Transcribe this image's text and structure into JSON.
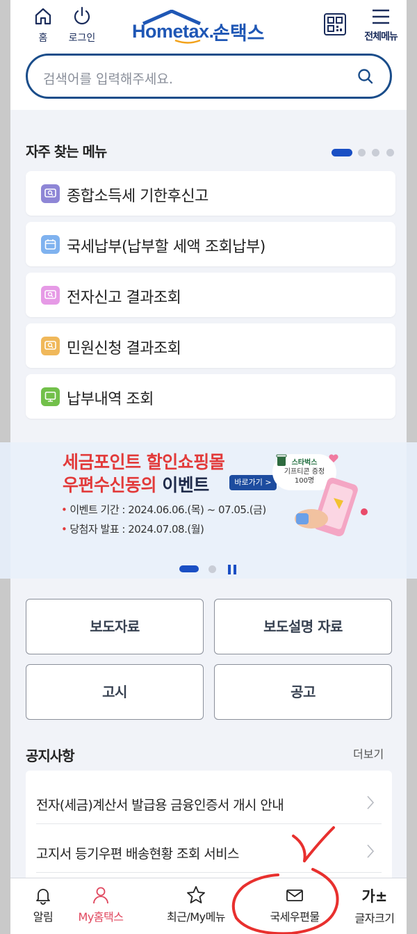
{
  "header": {
    "home_label": "홈",
    "login_label": "로그인",
    "logo_en": "Hometax.",
    "logo_ko": "손택스",
    "all_menu_label": "전체메뉴"
  },
  "search": {
    "placeholder": "검색어를 입력해주세요."
  },
  "favorites": {
    "title": "자주 찾는 메뉴",
    "items": [
      {
        "label": "종합소득세 기한후신고",
        "color": "#8e86d6"
      },
      {
        "label": "국세납부(납부할 세액 조회납부)",
        "color": "#7fb2ef"
      },
      {
        "label": "전자신고 결과조회",
        "color": "#e69ae6"
      },
      {
        "label": "민원신청 결과조회",
        "color": "#f0b85a"
      },
      {
        "label": "납부내역 조회",
        "color": "#72c04a"
      }
    ]
  },
  "banner": {
    "line1": "세금포인트 할인쇼핑몰",
    "line2_red": "우편수신동의",
    "line2_dark": " 이벤트",
    "go_label": "바로가기 >",
    "period": "이벤트 기간 : 2024.06.06.(목) ~ 07.05.(금)",
    "announce": "당첨자 발표 : 2024.07.08.(월)",
    "badge_brand": "스타벅스",
    "badge_line2": "기프티콘 증정",
    "badge_line3": "100명"
  },
  "quick_buttons": [
    "보도자료",
    "보도설명 자료",
    "고시",
    "공고"
  ],
  "notices": {
    "title": "공지사항",
    "more_label": "더보기",
    "items": [
      "전자(세금)계산서 발급용 금융인증서 개시 안내",
      "고지서 등기우편 배송현황 조회 서비스"
    ]
  },
  "tabbar": {
    "tabs": [
      "알림",
      "My홈택스",
      "최근/My메뉴",
      "국세우편물",
      "글자크기"
    ],
    "active_index": 1,
    "font_icon": "가±"
  },
  "colors": {
    "brand": "#1f57b5",
    "active_tab": "#e0475e",
    "banner_red": "#e23a3a"
  }
}
